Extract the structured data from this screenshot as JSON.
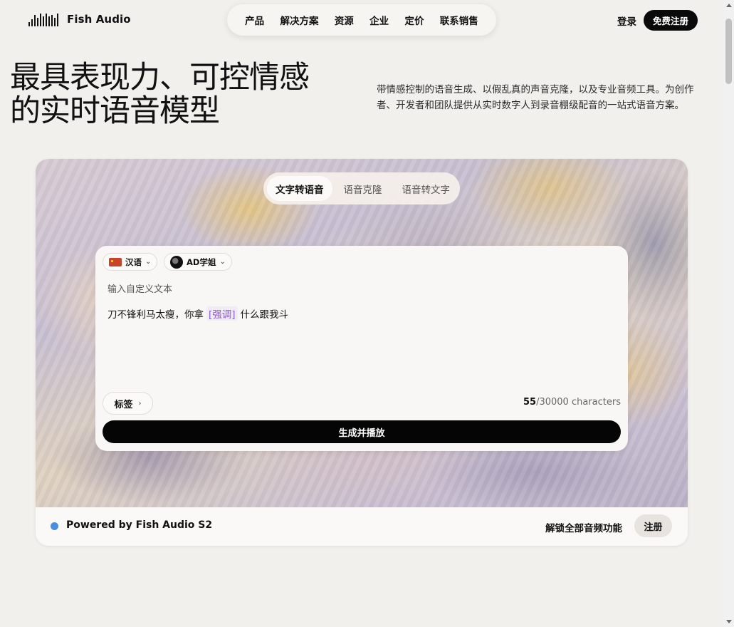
{
  "brand": {
    "name": "Fish Audio"
  },
  "nav": {
    "items": [
      "产品",
      "解决方案",
      "资源",
      "企业",
      "定价",
      "联系销售"
    ]
  },
  "auth": {
    "login": "登录",
    "signup": "免费注册"
  },
  "hero": {
    "title_line1": "最具表现力、可控情感",
    "title_line2": "的实时语音模型",
    "description": "带情感控制的语音生成、以假乱真的声音克隆，以及专业音频工具。为创作者、开发者和团队提供从实时数字人到录音棚级配音的一站式语音方案。"
  },
  "demo": {
    "tabs": [
      {
        "label": "文字转语音",
        "active": true
      },
      {
        "label": "语音克隆",
        "active": false
      },
      {
        "label": "语音转文字",
        "active": false
      }
    ],
    "language": "汉语",
    "voice": "AD学姐",
    "placeholder": "输入自定义文本",
    "text_before": "刀不锋利马太瘦，你拿",
    "text_tag": "[强调]",
    "text_after": "什么跟我斗",
    "tags_label": "标签",
    "char_count": "55",
    "char_limit": "/30000 characters",
    "generate_label": "生成并播放"
  },
  "footer": {
    "powered_by": "Powered by Fish Audio S2",
    "unlock": "解锁全部音频功能",
    "register": "注册",
    "status_color": "#4a8ee0"
  }
}
